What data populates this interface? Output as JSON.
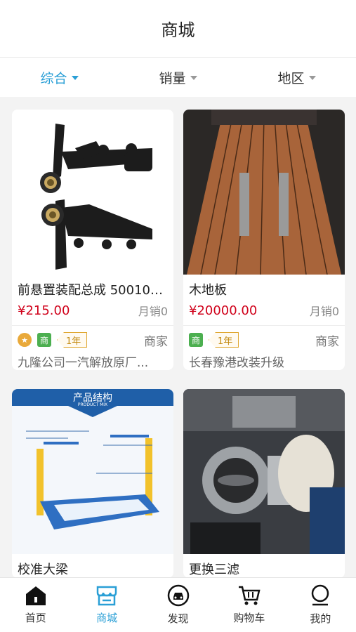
{
  "header": {
    "title": "商城"
  },
  "filters": [
    {
      "label": "综合",
      "active": true
    },
    {
      "label": "销量",
      "active": false
    },
    {
      "label": "地区",
      "active": false
    }
  ],
  "products": [
    {
      "name": "前悬置装配总成 500102...",
      "price": "¥215.00",
      "sold": "月销0",
      "badges": [
        "medal",
        "商",
        "1年"
      ],
      "merchant": "商家",
      "shop": "九隆公司一汽解放原厂...",
      "image": "bracket-part"
    },
    {
      "name": "木地板",
      "price": "¥20000.00",
      "sold": "月销0",
      "badges": [
        "商",
        "1年"
      ],
      "merchant": "商家",
      "shop": "长春豫港改装升级",
      "image": "wood-floor"
    },
    {
      "name": "校准大梁",
      "image": "frame-machine",
      "poster_title": "产品结构",
      "poster_subtitle": "PRODUCT MIX"
    },
    {
      "name": "更换三滤",
      "image": "throttle-body"
    }
  ],
  "tabbar": [
    {
      "label": "首页",
      "icon": "home-icon",
      "active": false
    },
    {
      "label": "商城",
      "icon": "store-icon",
      "active": true
    },
    {
      "label": "发现",
      "icon": "car-discover-icon",
      "active": false
    },
    {
      "label": "购物车",
      "icon": "cart-icon",
      "active": false
    },
    {
      "label": "我的",
      "icon": "profile-icon",
      "active": false
    }
  ],
  "colors": {
    "accent": "#2a9fd6",
    "price": "#d0021b"
  }
}
